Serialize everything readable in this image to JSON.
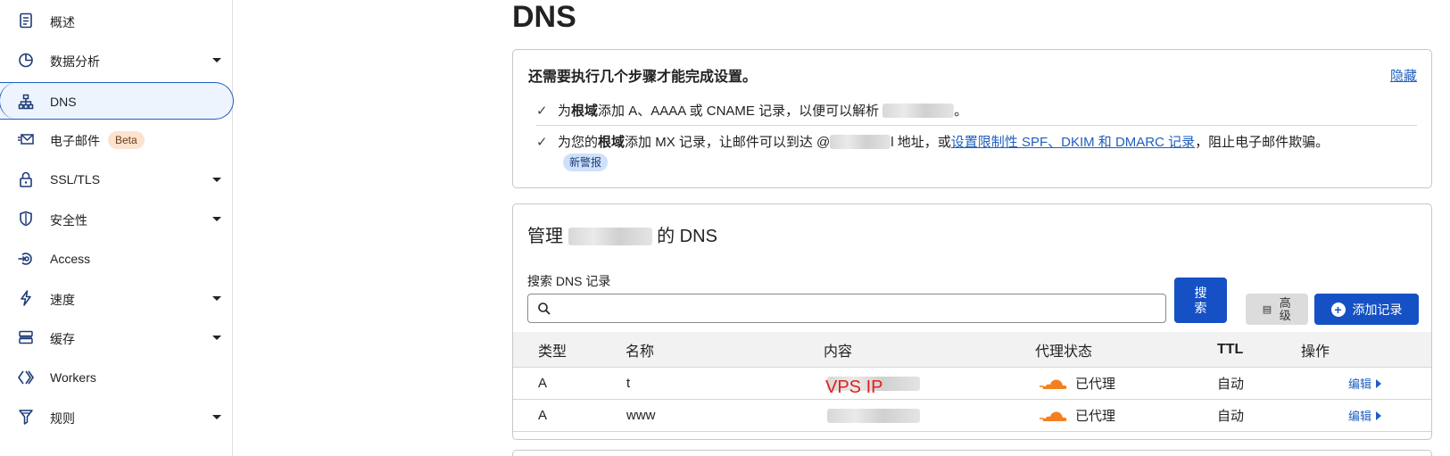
{
  "sidebar": {
    "items": [
      {
        "label": "概述",
        "icon": "document-icon"
      },
      {
        "label": "数据分析",
        "icon": "pie-chart-icon",
        "expandable": true
      },
      {
        "label": "DNS",
        "icon": "network-tree-icon",
        "active": true
      },
      {
        "label": "电子邮件",
        "icon": "mail-icon",
        "badge": "Beta"
      },
      {
        "label": "SSL/TLS",
        "icon": "lock-icon",
        "expandable": true
      },
      {
        "label": "安全性",
        "icon": "shield-icon",
        "expandable": true
      },
      {
        "label": "Access",
        "icon": "access-icon"
      },
      {
        "label": "速度",
        "icon": "lightning-icon",
        "expandable": true
      },
      {
        "label": "缓存",
        "icon": "server-stack-icon",
        "expandable": true
      },
      {
        "label": "Workers",
        "icon": "workers-icon"
      },
      {
        "label": "规则",
        "icon": "rules-icon",
        "expandable": true
      }
    ]
  },
  "page": {
    "title": "DNS"
  },
  "setup": {
    "title": "还需要执行几个步骤才能完成设置。",
    "hide_link": "隐藏",
    "step1": {
      "prefix": "为",
      "bold": "根域",
      "text": "添加 A、AAAA 或 CNAME 记录，以便可以解析 ",
      "suffix": "。"
    },
    "step2": {
      "prefix": "为您的",
      "bold": "根域",
      "text": "添加 MX 记录，让邮件可以到达 @",
      "mid": "l 地址，或",
      "link": "设置限制性 SPF、DKIM 和 DMARC 记录",
      "suffix": "，阻止电子邮件欺骗。"
    },
    "new_tag": "新警报"
  },
  "dns": {
    "title_prefix": "管理",
    "title_suffix": "的 DNS",
    "search_label": "搜索 DNS 记录",
    "search_value": "",
    "search_button": "搜索",
    "advanced_button": "高级",
    "add_button": "添加记录",
    "columns": [
      "类型",
      "名称",
      "内容",
      "代理状态",
      "TTL",
      "操作"
    ],
    "rows": [
      {
        "type": "A",
        "name": "t",
        "proxy": "已代理",
        "ttl": "自动",
        "action": "编辑"
      },
      {
        "type": "A",
        "name": "www",
        "proxy": "已代理",
        "ttl": "自动",
        "action": "编辑"
      }
    ],
    "annotation": "VPS IP"
  },
  "colors": {
    "accent": "#1551c4",
    "link": "#1f5fbf",
    "cloud": "#f38020",
    "annotation": "#e0201b",
    "beta_bg": "#fde3cf"
  }
}
